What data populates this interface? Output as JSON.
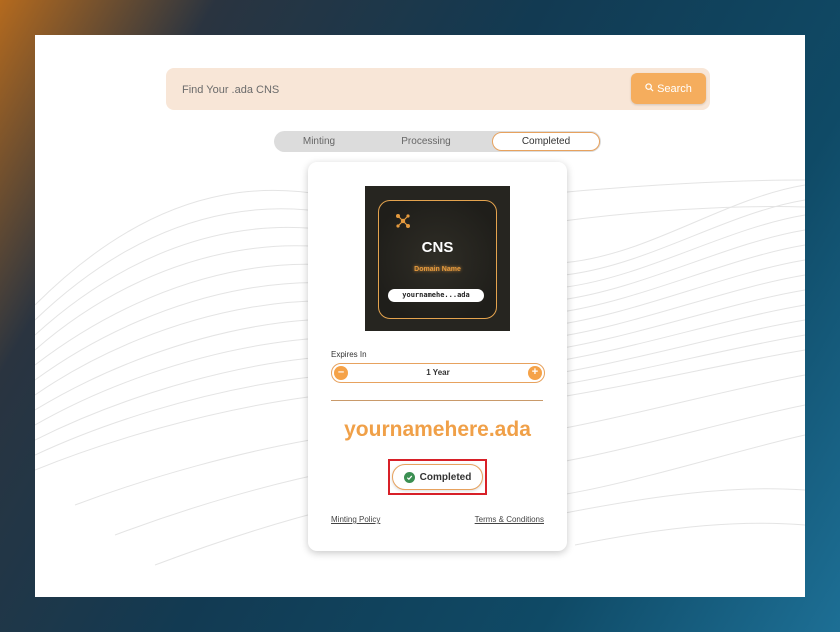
{
  "search": {
    "placeholder": "Find Your .ada CNS",
    "button_label": "Search"
  },
  "tabs": [
    {
      "label": "Minting",
      "active": false
    },
    {
      "label": "Processing",
      "active": false
    },
    {
      "label": "Completed",
      "active": true
    }
  ],
  "nft": {
    "title": "CNS",
    "subtitle": "Domain Name",
    "pill_text": "yournamehe...ada",
    "logo_icon": "network-nodes-icon"
  },
  "expires": {
    "label": "Expires In",
    "value": "1 Year"
  },
  "domain": {
    "name": "yournamehere.ada"
  },
  "status": {
    "label": "Completed",
    "icon": "check-circle-icon"
  },
  "links": {
    "minting_policy": "Minting Policy",
    "terms": "Terms & Conditions"
  },
  "colors": {
    "accent": "#f0a048",
    "button": "#f5ad5d",
    "search_bg": "#f8e6d7",
    "highlight": "#d82028",
    "success": "#3b8f52"
  }
}
